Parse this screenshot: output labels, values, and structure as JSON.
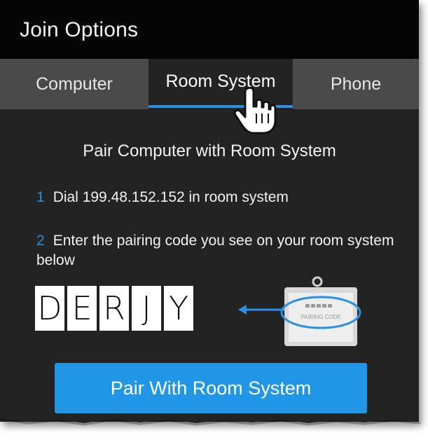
{
  "window": {
    "title": "Join Options"
  },
  "tabs": [
    {
      "label": "Computer",
      "active": false
    },
    {
      "label": "Room System",
      "active": true
    },
    {
      "label": "Phone",
      "active": false
    }
  ],
  "content": {
    "heading": "Pair Computer with Room System",
    "steps": [
      {
        "number": "1",
        "text": "Dial 199.48.152.152 in room system"
      },
      {
        "number": "2",
        "text": "Enter the pairing code you see on your room system below"
      }
    ],
    "pairing_code": [
      "D",
      "E",
      "R",
      "J",
      "Y"
    ],
    "device_screen_label": "PAIRING CODE",
    "pair_button_label": "Pair With Room System"
  },
  "colors": {
    "accent": "#2d8fe0",
    "button": "#2196e6",
    "panel_bg": "#232323",
    "title_bg": "#050505",
    "tab_bg": "#4a4a4a"
  },
  "icons": {
    "cursor": "hand-pointer-icon",
    "arrow": "arrow-left-icon",
    "device": "room-system-display-icon"
  }
}
